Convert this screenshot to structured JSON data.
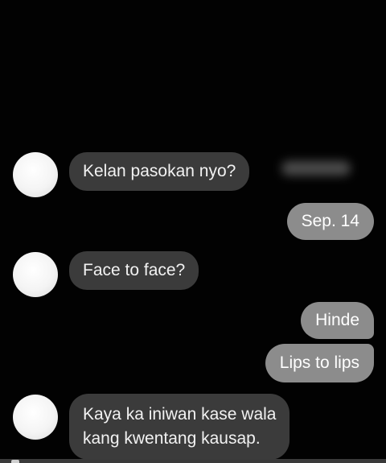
{
  "conversation": {
    "messages": [
      {
        "direction": "incoming",
        "text": "Kelan pasokan nyo?"
      },
      {
        "direction": "outgoing",
        "text": "Sep. 14"
      },
      {
        "direction": "incoming",
        "text": "Face to face?"
      },
      {
        "direction": "outgoing",
        "text": "Hinde"
      },
      {
        "direction": "outgoing",
        "text": "Lips to lips"
      },
      {
        "direction": "incoming",
        "lines": [
          "Kaya ka iniwan kase wala",
          "kang kwentang kausap."
        ]
      }
    ]
  },
  "colors": {
    "background": "#020202",
    "incoming_bubble": "#3b3b3b",
    "outgoing_bubble": "#8c8c8c",
    "text": "#f2f2f2"
  }
}
